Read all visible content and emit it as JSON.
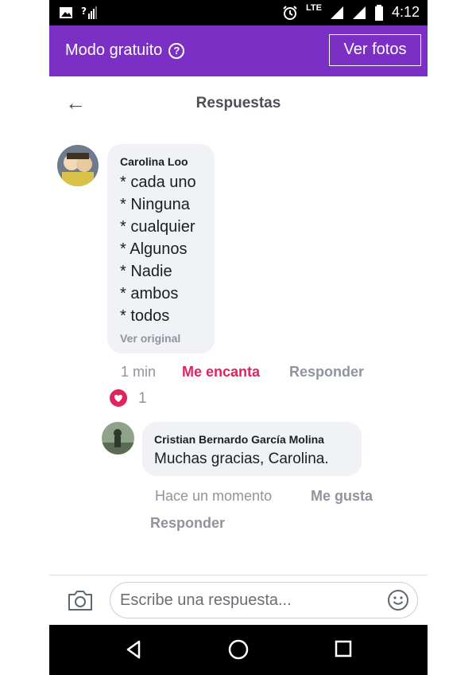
{
  "status_bar": {
    "network": "LTE",
    "time": "4:12"
  },
  "free_bar": {
    "label": "Modo gratuito",
    "help": "?",
    "button": "Ver fotos"
  },
  "header": {
    "back": "←",
    "title": "Respuestas"
  },
  "comment": {
    "author": "Carolina Loo",
    "lines": [
      "* cada uno",
      "* Ninguna",
      "* cualquier",
      "* Algunos",
      "* Nadie",
      "* ambos",
      "* todos"
    ],
    "see_original": "Ver original",
    "time": "1 min",
    "reaction_action": "Me encanta",
    "reply_action": "Responder",
    "reaction_count": "1"
  },
  "reply": {
    "author": "Cristian Bernardo García Molina",
    "text": "Muchas gracias, Carolina.",
    "time": "Hace un momento",
    "like_action": "Me gusta",
    "reply_action": "Responder"
  },
  "composer": {
    "placeholder": "Escribe una respuesta..."
  },
  "colors": {
    "accent": "#7b2fc4",
    "love": "#e0245e"
  }
}
